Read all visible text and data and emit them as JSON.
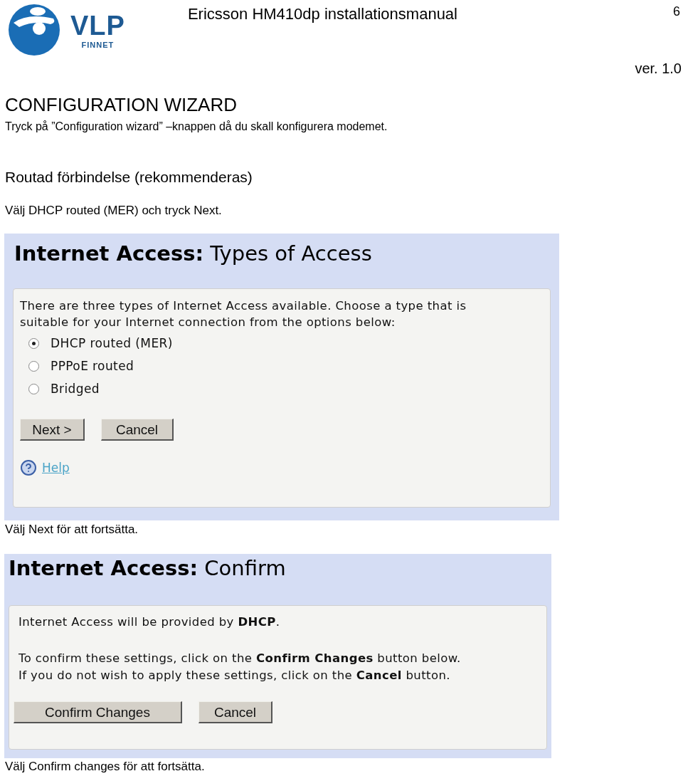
{
  "header": {
    "logo": {
      "wordmark": "VLP",
      "subtitle": "FINNET"
    },
    "title": "Ericsson HM410dp installationsmanual",
    "page_number": "6",
    "version": "ver. 1.0"
  },
  "heading": "CONFIGURATION WIZARD",
  "intro": "Tryck på ”Configuration wizard” –knappen då du skall konfigurera modemet.",
  "subheading": "Routad förbindelse (rekommenderas)",
  "instruction": "Välj DHCP routed (MER) och tryck Next.",
  "types_screen": {
    "title": "**Internet Access:** Types of Access",
    "lines": [
      "There are three types of Internet Access available. Choose a type that is",
      "suitable for your Internet connection from the options below:"
    ],
    "options": [
      {
        "label": "DHCP routed (MER)",
        "selected": true
      },
      {
        "label": "PPPoE routed",
        "selected": false
      },
      {
        "label": "Bridged",
        "selected": false
      }
    ],
    "buttons": [
      "Next >",
      "Cancel"
    ],
    "help_link": "Help"
  },
  "caption_1": "Välj Next för att fortsätta.",
  "confirm_screen": {
    "title": "**Internet Access:** Confirm",
    "summary": "Internet Access will be provided by **DHCP**.",
    "lines": [
      "To confirm these settings, click on the **Confirm Changes** button below.",
      "If you do not wish to apply these settings, click on the **Cancel** button."
    ],
    "buttons": [
      "Confirm Changes",
      "Cancel"
    ]
  },
  "caption_2": "Välj Confirm changes för att fortsätta."
}
